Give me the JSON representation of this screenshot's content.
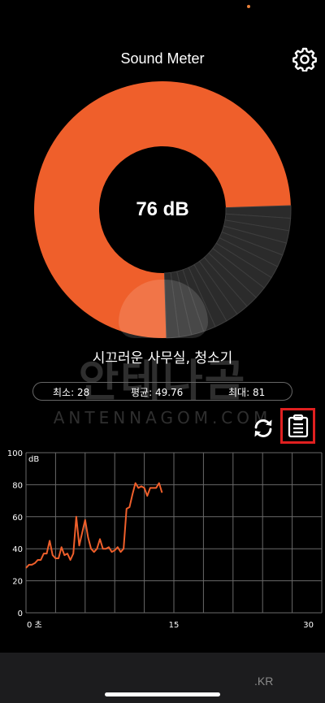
{
  "app": {
    "title": "Sound Meter"
  },
  "icons": {
    "settings": "gear-icon",
    "refresh": "refresh-icon",
    "clipboard": "clipboard-icon"
  },
  "gauge": {
    "value_label": "76 dB",
    "level_fraction": 0.75,
    "fill_color": "#ef5f2b",
    "empty_color": "#2b2b2b"
  },
  "noise_level": {
    "description": "시끄러운 사무실, 청소기"
  },
  "stats": {
    "min": "최소: 28",
    "avg": "평균: 49.76",
    "max": "최대: 81"
  },
  "watermark": {
    "korean": "안테나곰",
    "english": "ANTENNAGOM.COM"
  },
  "bottom": {
    "domain_suffix": ".KR"
  },
  "colors": {
    "accent": "#ef5f2b",
    "highlight_box": "#e02020"
  },
  "chart_data": {
    "type": "line",
    "ylabel": "dB",
    "ylim": [
      0,
      100
    ],
    "xlim": [
      0,
      30
    ],
    "y_ticks": [
      "100",
      "80",
      "60",
      "40",
      "20",
      "0"
    ],
    "x_ticks": [
      "0 초",
      "15",
      "30"
    ],
    "grid": true,
    "series": [
      {
        "color": "#ef5f2b",
        "x": [
          0,
          0.3,
          0.6,
          0.9,
          1.2,
          1.5,
          1.8,
          2.1,
          2.4,
          2.7,
          3.0,
          3.3,
          3.6,
          3.9,
          4.2,
          4.5,
          4.8,
          5.1,
          5.4,
          5.7,
          6.0,
          6.3,
          6.6,
          6.9,
          7.2,
          7.5,
          7.8,
          8.1,
          8.4,
          8.7,
          9.0,
          9.3,
          9.6,
          9.9,
          10.2,
          10.5,
          10.8,
          11.1,
          11.4,
          11.7,
          12.0,
          12.3,
          12.6,
          12.9,
          13.2,
          13.5,
          13.8
        ],
        "y": [
          28,
          30,
          30,
          31,
          33,
          33,
          37,
          37,
          45,
          36,
          34,
          34,
          41,
          36,
          37,
          33,
          37,
          60,
          42,
          50,
          58,
          47,
          40,
          38,
          40,
          46,
          40,
          40,
          41,
          38,
          39,
          41,
          38,
          40,
          65,
          66,
          74,
          81,
          78,
          79,
          78,
          73,
          78,
          78,
          78,
          81,
          75
        ]
      }
    ]
  }
}
